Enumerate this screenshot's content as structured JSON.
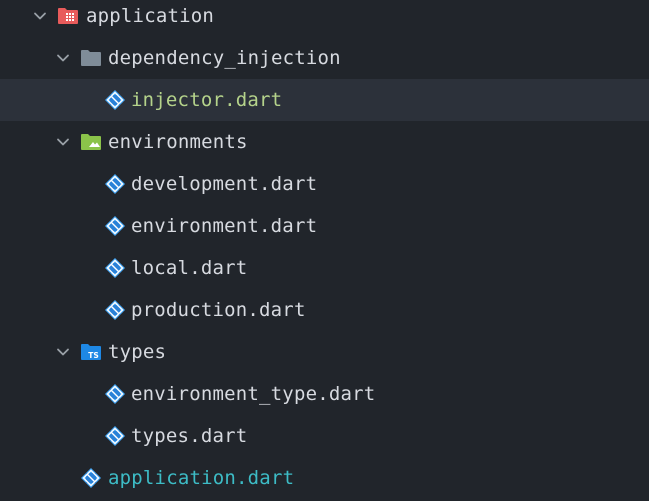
{
  "tree": {
    "root": {
      "label": "application",
      "icon": "app-folder-icon"
    },
    "dependency_injection": {
      "label": "dependency_injection",
      "icon": "folder-icon",
      "children": [
        {
          "label": "injector.dart",
          "icon": "dart-file-icon",
          "selected": true
        }
      ]
    },
    "environments": {
      "label": "environments",
      "icon": "environment-folder-icon",
      "children": [
        {
          "label": "development.dart",
          "icon": "dart-file-icon"
        },
        {
          "label": "environment.dart",
          "icon": "dart-file-icon"
        },
        {
          "label": "local.dart",
          "icon": "dart-file-icon"
        },
        {
          "label": "production.dart",
          "icon": "dart-file-icon"
        }
      ]
    },
    "types": {
      "label": "types",
      "icon": "typescript-folder-icon",
      "icon_text": "TS",
      "children": [
        {
          "label": "environment_type.dart",
          "icon": "dart-file-icon"
        },
        {
          "label": "types.dart",
          "icon": "dart-file-icon"
        }
      ]
    },
    "root_file": {
      "label": "application.dart",
      "icon": "dart-file-icon"
    }
  },
  "colors": {
    "background": "#21252b",
    "selected_row": "#2c313a",
    "text": "#d7dae0",
    "selected_text": "#b5d38b",
    "root_file_text": "#3dbcc6",
    "dart_icon": "#42a5f5",
    "folder": "#7f8c98",
    "env_folder": "#8bc34a",
    "ts_folder": "#1e88e5",
    "app_folder": "#e85b5b",
    "chevron": "#9aa0a8"
  }
}
